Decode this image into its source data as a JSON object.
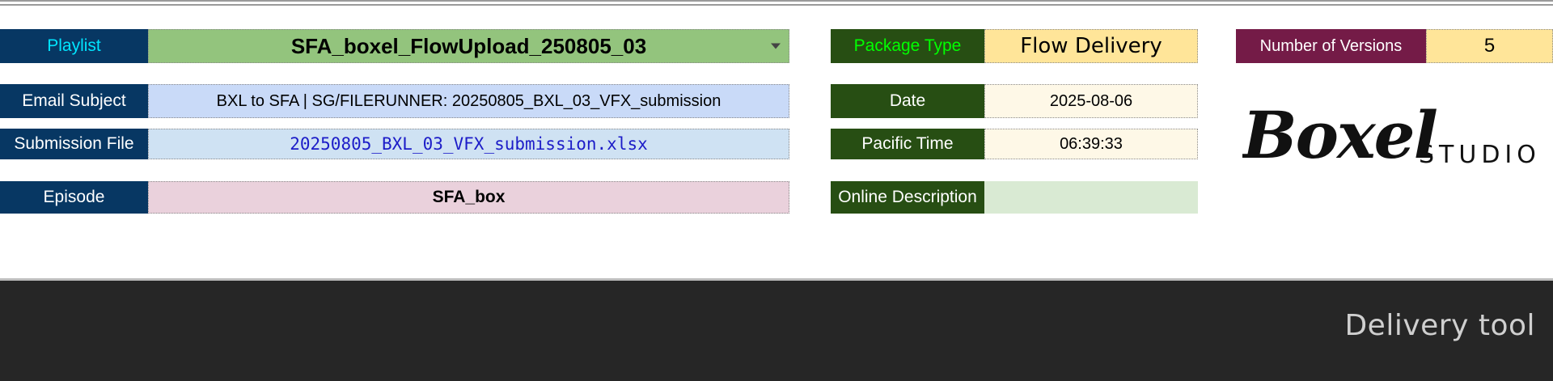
{
  "row1": {
    "playlist_label": "Playlist",
    "playlist_value": "SFA_boxel_FlowUpload_250805_03",
    "package_type_label": "Package Type",
    "package_type_value": "Flow Delivery",
    "num_versions_label": "Number of Versions",
    "num_versions_value": "5"
  },
  "row2": {
    "email_subject_label": "Email Subject",
    "email_subject_value": "BXL to SFA |  SG/FILERUNNER: 20250805_BXL_03_VFX_submission",
    "date_label": "Date",
    "date_value": "2025-08-06"
  },
  "row3": {
    "submission_file_label": "Submission File",
    "submission_file_value": "20250805_BXL_03_VFX_submission.xlsx",
    "pacific_time_label": "Pacific Time",
    "pacific_time_value": "06:39:33"
  },
  "row4": {
    "episode_label": "Episode",
    "episode_value": "SFA_box",
    "online_description_label": "Online Description",
    "online_description_value": ""
  },
  "logo": {
    "wordmark": "Boxel",
    "subtitle": "STUDIO"
  },
  "footer": {
    "title": "Delivery tool"
  },
  "icons": {
    "dropdown": "chevron-down-icon"
  },
  "colors": {
    "label_navy": "#073763",
    "label_dark_green": "#274e13",
    "label_maroon": "#741b47",
    "playlist_value_bg": "#93c47d",
    "playlist_label_text": "#00e5ff",
    "package_label_text": "#00ff00",
    "file_link_text": "#1c1cc8",
    "footer_bg": "#262626"
  }
}
